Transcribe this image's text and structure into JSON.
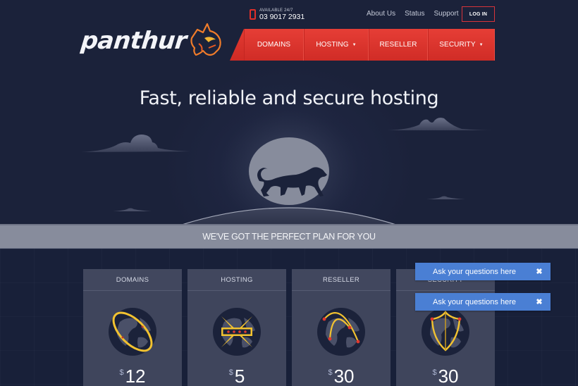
{
  "header": {
    "phone_available": "AVAILABLE 24/7",
    "phone_number": "03 9017 2931",
    "top_links": [
      "About Us",
      "Status",
      "Support"
    ],
    "login_label": "LOG IN",
    "logo_text": "panthur"
  },
  "nav": {
    "items": [
      {
        "label": "DOMAINS",
        "has_dropdown": false
      },
      {
        "label": "HOSTING",
        "has_dropdown": true
      },
      {
        "label": "RESELLER",
        "has_dropdown": false
      },
      {
        "label": "SECURITY",
        "has_dropdown": true
      }
    ],
    "caret": "▼"
  },
  "hero": {
    "headline": "Fast, reliable and secure hosting"
  },
  "banner": {
    "text": "WE'VE GOT THE PERFECT PLAN FOR YOU"
  },
  "plans": [
    {
      "title": "DOMAINS",
      "currency": "$",
      "price": "12",
      "icon": "globe-orbit-icon"
    },
    {
      "title": "HOSTING",
      "currency": "$",
      "price": "5",
      "icon": "globe-server-icon"
    },
    {
      "title": "RESELLER",
      "currency": "$",
      "price": "30",
      "icon": "globe-network-icon"
    },
    {
      "title": "SECURITY",
      "currency": "$",
      "price": "30",
      "icon": "globe-shield-icon"
    }
  ],
  "chat": [
    {
      "text": "Ask your questions here",
      "close": "✖"
    },
    {
      "text": "Ask your questions here",
      "close": "✖"
    }
  ],
  "colors": {
    "background": "#1b223a",
    "accent_red": "#e03a32",
    "banner": "#878c9c",
    "card": "#3f455c",
    "chat_blue": "#4a7fd4",
    "icon_gold": "#f0c030"
  }
}
